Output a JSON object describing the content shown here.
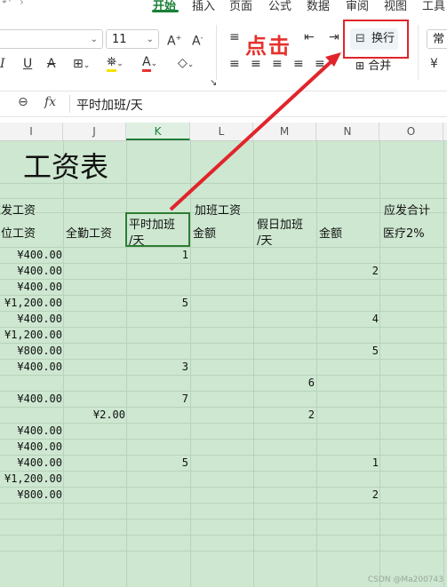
{
  "ribbon": {
    "tabs": [
      "开始",
      "插入",
      "页面",
      "公式",
      "数据",
      "审阅",
      "视图",
      "工具"
    ],
    "font_size": "11",
    "font_name_partial": "常",
    "wrap_button_label": "换行",
    "merge_label": "合并",
    "callout_text": "点击",
    "icons": [
      "undo-icon",
      "redo-icon",
      "grow-font-icon",
      "shrink-font-icon",
      "italic-icon",
      "underline-icon",
      "strikethrough-icon",
      "borders-icon",
      "fill-color-icon",
      "font-color-icon",
      "clear-format-icon",
      "align-top-icon",
      "align-middle-icon",
      "indent-decrease-icon",
      "indent-increase-icon",
      "wrap-text-icon",
      "merge-cells-icon",
      "currency-icon"
    ]
  },
  "formula_bar": {
    "content": "平时加班/天"
  },
  "columns": [
    {
      "id": "I",
      "selected": false
    },
    {
      "id": "J",
      "selected": false
    },
    {
      "id": "K",
      "selected": true
    },
    {
      "id": "L",
      "selected": false
    },
    {
      "id": "M",
      "selected": false
    },
    {
      "id": "N",
      "selected": false
    },
    {
      "id": "O",
      "selected": false
    }
  ],
  "sheet": {
    "title": "工资表",
    "header1": {
      "I": "应发工资",
      "L": "加班工资",
      "O": "应发合计"
    },
    "header2": {
      "I": "岗位工资",
      "J": "全勤工资",
      "K1": "平时加班",
      "K2": "/天",
      "L": "金额",
      "M1": "假日加班",
      "M2": "/天",
      "N": "金额",
      "O": "医疗2%"
    },
    "rows": [
      {
        "I": "¥400.00",
        "J": "",
        "K": "1",
        "M": "",
        "N": ""
      },
      {
        "I": "¥400.00",
        "J": "",
        "K": "",
        "M": "",
        "N": "2"
      },
      {
        "I": "¥400.00",
        "J": "",
        "K": "",
        "M": "",
        "N": ""
      },
      {
        "I": "¥1,200.00",
        "J": "",
        "K": "5",
        "M": "",
        "N": ""
      },
      {
        "I": "¥400.00",
        "J": "",
        "K": "",
        "M": "",
        "N": "4"
      },
      {
        "I": "¥1,200.00",
        "J": "",
        "K": "",
        "M": "",
        "N": ""
      },
      {
        "I": "¥800.00",
        "J": "",
        "K": "",
        "M": "",
        "N": "5"
      },
      {
        "I": "¥400.00",
        "J": "",
        "K": "3",
        "M": "",
        "N": ""
      },
      {
        "I": "",
        "J": "",
        "K": "",
        "M": "6",
        "N": ""
      },
      {
        "I": "¥400.00",
        "J": "",
        "K": "7",
        "M": "",
        "N": ""
      },
      {
        "I": "",
        "J": "¥2.00",
        "K": "",
        "M": "2",
        "N": ""
      },
      {
        "I": "¥400.00",
        "J": "",
        "K": "",
        "M": "",
        "N": ""
      },
      {
        "I": "¥400.00",
        "J": "",
        "K": "",
        "M": "",
        "N": ""
      },
      {
        "I": "¥400.00",
        "J": "",
        "K": "5",
        "M": "",
        "N": "1"
      },
      {
        "I": "¥1,200.00",
        "J": "",
        "K": "",
        "M": "",
        "N": ""
      },
      {
        "I": "¥800.00",
        "J": "",
        "K": "",
        "M": "",
        "N": "2"
      }
    ]
  },
  "watermark": "CSDN @Ma200743",
  "colors": {
    "accent": "#1a7f37",
    "sheet_bg": "#cde7d0",
    "annotation_red": "#e1242b"
  }
}
